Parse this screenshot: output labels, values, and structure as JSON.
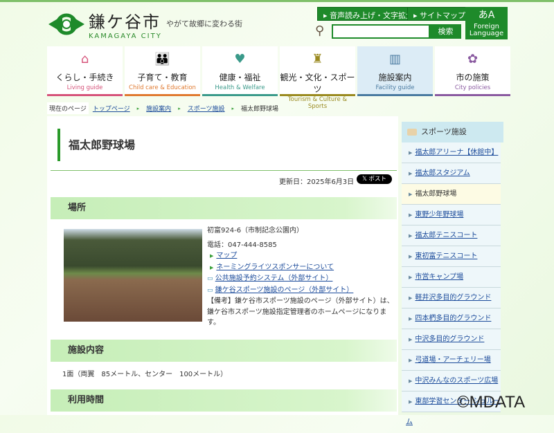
{
  "header": {
    "logo_jp": "鎌ケ谷市",
    "logo_en": "KAMAGAYA CITY",
    "tagline": "やがて故郷に変わる街",
    "voice_btn": "音声読み上げ・文字拡大",
    "sitemap_btn": "サイトマップ",
    "search_placeholder": "",
    "search_btn": "検索",
    "lang_icon": "あA",
    "lang_label1": "Foreign",
    "lang_label2": "Language"
  },
  "nav": [
    {
      "jp": "くらし・手続き",
      "en": "Living guide",
      "color": "#d6537a",
      "icon": "house-icon"
    },
    {
      "jp": "子育て・教育",
      "en": "Child care & Education",
      "color": "#e07a30",
      "icon": "family-icon"
    },
    {
      "jp": "健康・福祉",
      "en": "Health & Welfare",
      "color": "#3a9a8a",
      "icon": "heart-icon"
    },
    {
      "jp": "観光・文化・スポーツ",
      "en": "Tourism & Culture & Sports",
      "color": "#9a8a20",
      "icon": "statue-icon"
    },
    {
      "jp": "施設案内",
      "en": "Facility guide",
      "color": "#4a7aa0",
      "icon": "building-icon"
    },
    {
      "jp": "市の施策",
      "en": "City policies",
      "color": "#8a5aa0",
      "icon": "flower-icon"
    }
  ],
  "breadcrumb": {
    "label": "現在のページ",
    "items": [
      "トップページ",
      "施設案内",
      "スポーツ施設"
    ],
    "current": "福太郎野球場"
  },
  "page": {
    "title": "福太郎野球場",
    "updated": "更新日：2025年6月3日",
    "post_btn": "𝕏 ポスト",
    "sections": {
      "location": "場所",
      "content": "施設内容",
      "hours": "利用時間"
    },
    "address": "初富924-6（市制記念公園内）",
    "phone": "電話：047-444-8585",
    "links": [
      "マップ",
      "ネーミングライツスポンサーについて"
    ],
    "ext_links": [
      "公共施設予約システム（外部サイト）",
      "鎌ケ谷スポーツ施設のページ（外部サイト）"
    ],
    "note": "【備考】鎌ケ谷市スポーツ施設のページ（外部サイト）は、鎌ケ谷市スポーツ施設指定管理者のホームページになります。",
    "facility": "1面（両翼　85メートル、センター　100メートル）"
  },
  "sidebar": {
    "title": "スポーツ施設",
    "items": [
      "福太郎アリーナ【休館中】",
      "福太郎スタジアム",
      "福太郎野球場",
      "東野少年野球場",
      "福太郎テニスコート",
      "東初富テニスコート",
      "市営キャンプ場",
      "軽井沢多目的グラウンド",
      "四本椚多目的グラウンド",
      "中沢多目的グラウンド",
      "弓道場・アーチェリー場",
      "中沢みんなのスポーツ広場",
      "東部学習センター シュルーム"
    ],
    "current_index": 2
  },
  "watermark": "©MDATA"
}
